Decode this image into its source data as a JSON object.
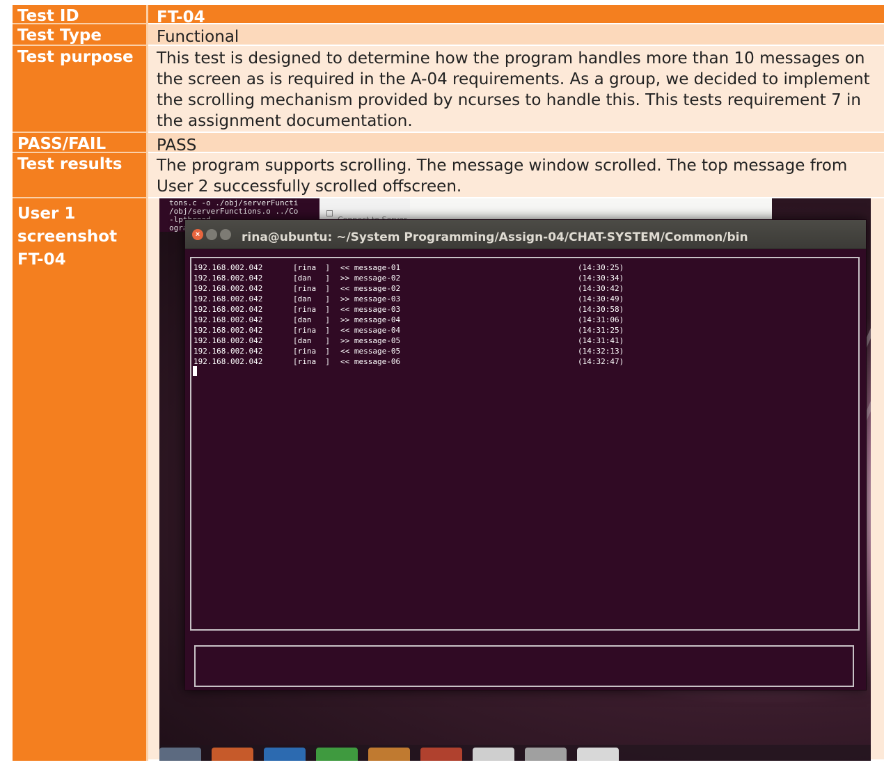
{
  "table": {
    "id_label": "Test ID",
    "id_value": "FT-04",
    "type_label": "Test Type",
    "type_value": "Functional",
    "purpose_label": "Test purpose",
    "purpose_value": "This test is designed to determine how the program handles more than 10 messages on the screen as is required in the A-04 requirements. As a group, we decided to implement the scrolling mechanism provided by ncurses to handle this. This tests requirement 7 in the assignment documentation.",
    "pass_label": "PASS/FAIL",
    "pass_value": "PASS",
    "results_label": "Test results",
    "results_value": "The program supports scrolling. The message window scrolled. The top message from User 2 successfully scrolled offscreen.",
    "screenshot_label_1": "User 1",
    "screenshot_label_2": "screenshot",
    "screenshot_label_3": "FT-04"
  },
  "screenshot": {
    "back_terminal_lines": [
      "tons.c -o ./obj/serverFuncti",
      "/obj/serverFunctions.o ../Co",
      "-lpthread",
      "ogram"
    ],
    "back_dialog_label": "Connect to Server",
    "window_title": "rina@ubuntu: ~/System Programming/Assign-04/CHAT-SYSTEM/Common/bin",
    "messages": [
      {
        "ip": "192.168.002.042",
        "user": "[rina  ]",
        "dir_msg": "<< message-01",
        "time": "(14:30:25)"
      },
      {
        "ip": "192.168.002.042",
        "user": "[dan   ]",
        "dir_msg": ">> message-02",
        "time": "(14:30:34)"
      },
      {
        "ip": "192.168.002.042",
        "user": "[rina  ]",
        "dir_msg": "<< message-02",
        "time": "(14:30:42)"
      },
      {
        "ip": "192.168.002.042",
        "user": "[dan   ]",
        "dir_msg": ">> message-03",
        "time": "(14:30:49)"
      },
      {
        "ip": "192.168.002.042",
        "user": "[rina  ]",
        "dir_msg": "<< message-03",
        "time": "(14:30:58)"
      },
      {
        "ip": "192.168.002.042",
        "user": "[dan   ]",
        "dir_msg": ">> message-04",
        "time": "(14:31:06)"
      },
      {
        "ip": "192.168.002.042",
        "user": "[rina  ]",
        "dir_msg": "<< message-04",
        "time": "(14:31:25)"
      },
      {
        "ip": "192.168.002.042",
        "user": "[dan   ]",
        "dir_msg": ">> message-05",
        "time": "(14:31:41)"
      },
      {
        "ip": "192.168.002.042",
        "user": "[rina  ]",
        "dir_msg": "<< message-05",
        "time": "(14:32:13)"
      },
      {
        "ip": "192.168.002.042",
        "user": "[rina  ]",
        "dir_msg": "<< message-06",
        "time": "(14:32:47)"
      }
    ],
    "close_glyph": "×"
  }
}
